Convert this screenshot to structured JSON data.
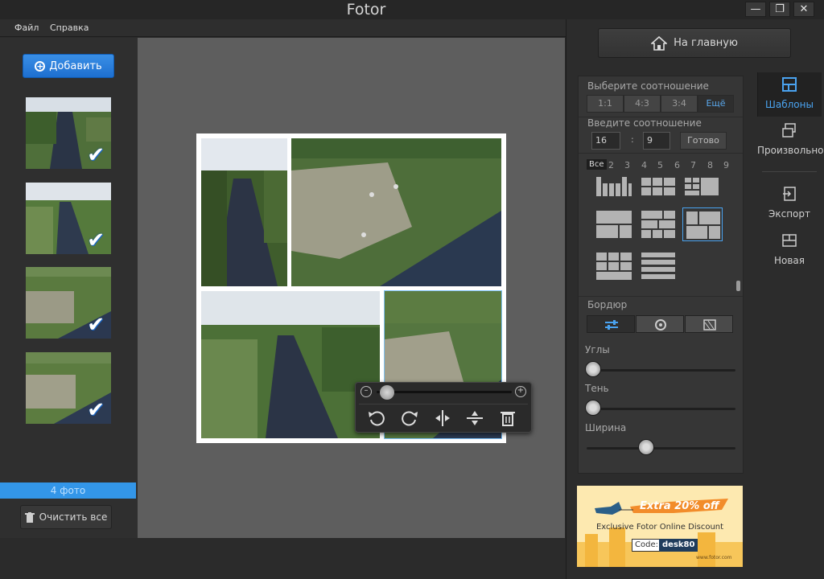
{
  "window": {
    "title": "Fotor",
    "controls": [
      "minimize",
      "maximize",
      "close"
    ]
  },
  "menu": {
    "items": [
      "Файл",
      "Справка"
    ]
  },
  "left_panel": {
    "add_label": "Добавить",
    "photo_count": "4 фото",
    "clear_all_label": "Очистить все"
  },
  "right_panel": {
    "home_label": "На главную",
    "ratio_section": "Выберите соотношение",
    "ratios": [
      "1:1",
      "4:3",
      "3:4",
      "Ещё"
    ],
    "selected_ratio": "Ещё",
    "custom_ratio_section": "Введите соотношение",
    "ratio_width": "16",
    "ratio_separator": ":",
    "ratio_height": "9",
    "done_label": "Готово",
    "photo_count_tabs": [
      "Все",
      "2",
      "3",
      "4",
      "5",
      "6",
      "7",
      "8",
      "9"
    ],
    "border_section": "Бордюр",
    "corners_label": "Углы",
    "shadow_label": "Тень",
    "width_label": "Ширина",
    "sliders": {
      "corners": 0.0,
      "shadow": 0.0,
      "width": 0.4
    }
  },
  "side_nav": {
    "items": [
      "Шаблоны",
      "Произвольно",
      "Экспорт",
      "Новая"
    ],
    "active": "Шаблоны"
  },
  "ad": {
    "headline": "Extra 20% off",
    "subline": "Exclusive Fotor Online Discount",
    "code_label": "Code:",
    "code_value": "desk80",
    "site": "www.fotor.com"
  },
  "canvas": {
    "zoom_level": 0.05
  },
  "colors": {
    "accent": "#3396e8",
    "panel": "#363636",
    "canvas_bg": "#5e5e5e"
  }
}
